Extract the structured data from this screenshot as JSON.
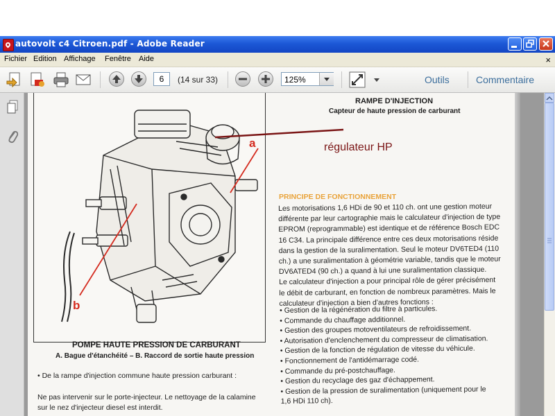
{
  "window": {
    "title": "autovolt c4 Citroen.pdf - Adobe Reader",
    "app_icon": "adobe-reader-icon"
  },
  "menu": {
    "items": [
      "Fichier",
      "Edition",
      "Affichage",
      "Fenêtre",
      "Aide"
    ],
    "close_glyph": "×"
  },
  "toolbar": {
    "page_value": "6",
    "page_count": "(14 sur 33)",
    "zoom": "125%",
    "tools_label": "Outils",
    "comment_label": "Commentaire"
  },
  "document": {
    "figure_caption_title": "POMPE HAUTE PRESSION DE CARBURANT",
    "figure_caption_sub": "A. Bague d'étanchéité – B. Raccord de sortie haute pression",
    "label_a": "a",
    "label_b": "b",
    "left_text_1": "• De la rampe d'injection commune haute pression carburant :",
    "left_text_2": [
      "Ne pas intervenir sur le porte-injecteur. Le nettoyage de la calamine",
      "sur le nez d'injecteur diesel est interdit."
    ],
    "section_title": "RAMPE D'INJECTION",
    "section_subtitle": "Capteur de haute pression de carburant",
    "annotation": "régulateur HP",
    "principe_heading": "PRINCIPE DE FONCTIONNEMENT",
    "paragraph_lines": [
      "Les motorisations 1,6 HDi de 90 et 110 ch. ont une gestion moteur",
      "différente par leur cartographie mais le calculateur d'injection de type",
      "EPROM (reprogrammable) est identique et de référence Bosch EDC",
      "16 C34. La principale différence entre ces deux motorisations réside",
      "dans la gestion de la suralimentation. Seul le moteur DV6TED4 (110",
      "ch.) a une suralimentation à géométrie variable, tandis que le moteur",
      "DV6ATED4 (90 ch.) a quand à lui une suralimentation classique.",
      "Le calculateur d'injection a pour principal rôle de gérer précisément",
      "le débit de carburant, en fonction de nombreux paramètres. Mais le",
      "calculateur d'injection a bien d'autres fonctions :"
    ],
    "bullets": [
      "• Gestion de la régénération du filtre à particules.",
      "• Commande du chauffage additionnel.",
      "• Gestion des groupes motoventilateurs de refroidissement.",
      "• Autorisation d'enclenchement du compresseur de climatisation.",
      "• Gestion de la fonction de régulation de vitesse du véhicule.",
      "• Fonctionnement de l'antidémarrage codé.",
      "• Commande du pré-postchauffage.",
      "• Gestion du recyclage des gaz d'échappement.",
      "• Gestion de la pression de suralimentation (uniquement pour le",
      "1,6 HDi 110 ch)."
    ]
  },
  "colors": {
    "titlebar": "#1c58d6",
    "annotation": "#7a1414",
    "label_red": "#d42a1e",
    "heading_orange": "#e9a33a",
    "link_blue": "#3c6e9c"
  }
}
